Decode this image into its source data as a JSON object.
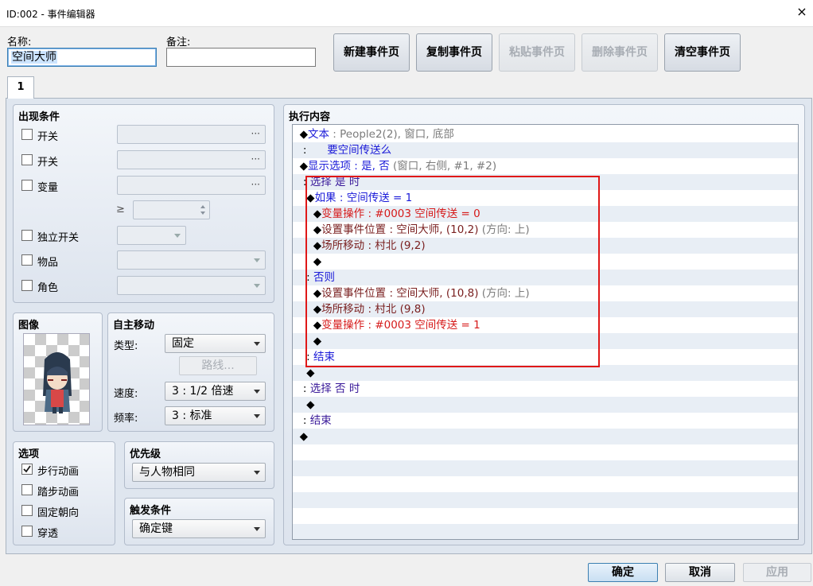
{
  "window": {
    "title": "ID:002 - 事件编辑器",
    "close_glyph": "×"
  },
  "header": {
    "name_label": "名称:",
    "name_value": "空间大师",
    "note_label": "备注:",
    "note_value": ""
  },
  "page_buttons": [
    "新建事件页",
    "复制事件页",
    "粘贴事件页",
    "删除事件页",
    "清空事件页"
  ],
  "tab": {
    "label": "1"
  },
  "conditions": {
    "title": "出现条件",
    "switch1": "开关",
    "switch2": "开关",
    "variable": "变量",
    "gte": "≥",
    "self_switch": "独立开关",
    "item": "物品",
    "actor": "角色",
    "ellipsis": "···"
  },
  "image": {
    "title": "图像",
    "icon": "character-sprite-icon"
  },
  "autonomous": {
    "title": "自主移动",
    "type_label": "类型:",
    "type_value": "固定",
    "route_button": "路线...",
    "speed_label": "速度:",
    "speed_value": "3 : 1/2 倍速",
    "freq_label": "频率:",
    "freq_value": "3 : 标准"
  },
  "options": {
    "title": "选项",
    "walking": "步行动画",
    "stepping": "踏步动画",
    "direction_fix": "固定朝向",
    "through": "穿透",
    "walking_checked": true
  },
  "priority": {
    "title": "优先级",
    "value": "与人物相同"
  },
  "trigger": {
    "title": "触发条件",
    "value": "确定键"
  },
  "contents": {
    "title": "执行内容",
    "lines": [
      [
        [
          "◆",
          "c-blk"
        ],
        [
          "文本",
          "c-blue"
        ],
        [
          " : People2(2), 窗口, 底部",
          "c-gray"
        ]
      ],
      [
        [
          " :      ",
          "c-blk"
        ],
        [
          "要空间传送么",
          "c-blue"
        ]
      ],
      [
        [
          "◆",
          "c-blk"
        ],
        [
          "显示选项",
          "c-blue"
        ],
        [
          " : 是, 否 ",
          "c-blue"
        ],
        [
          "(窗口, 右侧, #1, #2)",
          "c-gray"
        ]
      ],
      [
        [
          " : ",
          "c-blk"
        ],
        [
          "选择 是 时",
          "c-purple"
        ]
      ],
      [
        [
          "  ◆",
          "c-blk"
        ],
        [
          "如果",
          "c-blue"
        ],
        [
          " : 空间传送 = 1",
          "c-blue"
        ]
      ],
      [
        [
          "    ◆",
          "c-blk"
        ],
        [
          "变量操作 : #0003 空间传送 = 0",
          "c-red"
        ]
      ],
      [
        [
          "    ◆",
          "c-blk"
        ],
        [
          "设置事件位置 : 空间大师, (10,2) ",
          "c-brown"
        ],
        [
          "(方向: 上)",
          "c-gray"
        ]
      ],
      [
        [
          "    ◆",
          "c-blk"
        ],
        [
          "场所移动 : 村北 (9,2)",
          "c-brown"
        ]
      ],
      [
        [
          "    ◆",
          "c-blk"
        ]
      ],
      [
        [
          "  : ",
          "c-blk"
        ],
        [
          "否则",
          "c-blue"
        ]
      ],
      [
        [
          "    ◆",
          "c-blk"
        ],
        [
          "设置事件位置 : 空间大师, (10,8) ",
          "c-brown"
        ],
        [
          "(方向: 上)",
          "c-gray"
        ]
      ],
      [
        [
          "    ◆",
          "c-blk"
        ],
        [
          "场所移动 : 村北 (9,8)",
          "c-brown"
        ]
      ],
      [
        [
          "    ◆",
          "c-blk"
        ],
        [
          "变量操作 : #0003 空间传送 = 1",
          "c-red"
        ]
      ],
      [
        [
          "    ◆",
          "c-blk"
        ]
      ],
      [
        [
          "  : ",
          "c-blk"
        ],
        [
          "结束",
          "c-blue"
        ]
      ],
      [
        [
          "  ◆",
          "c-blk"
        ]
      ],
      [
        [
          " : ",
          "c-blk"
        ],
        [
          "选择 否 时",
          "c-purple"
        ]
      ],
      [
        [
          "  ◆",
          "c-blk"
        ]
      ],
      [
        [
          " : ",
          "c-blk"
        ],
        [
          "结束",
          "c-purple"
        ]
      ],
      [
        [
          "◆",
          "c-blk"
        ]
      ]
    ]
  },
  "footer": {
    "ok": "确定",
    "cancel": "取消",
    "apply": "应用"
  }
}
